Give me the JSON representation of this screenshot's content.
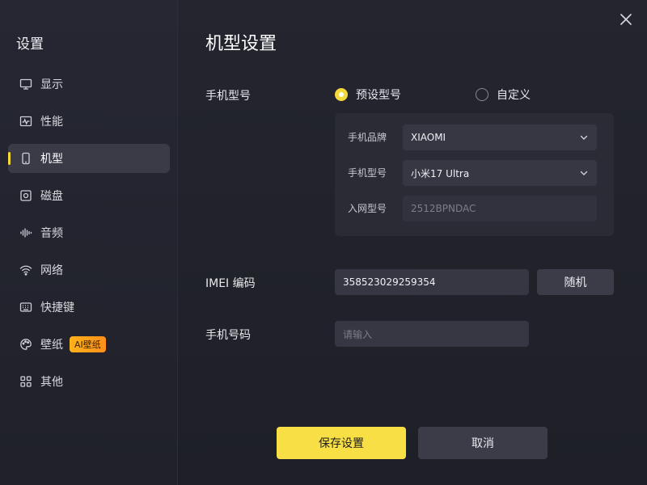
{
  "sidebar": {
    "title": "设置",
    "items": [
      {
        "label": "显示",
        "icon": "monitor-icon"
      },
      {
        "label": "性能",
        "icon": "performance-icon"
      },
      {
        "label": "机型",
        "icon": "phone-icon",
        "active": true
      },
      {
        "label": "磁盘",
        "icon": "disk-icon"
      },
      {
        "label": "音频",
        "icon": "audio-icon"
      },
      {
        "label": "网络",
        "icon": "wifi-icon"
      },
      {
        "label": "快捷键",
        "icon": "keyboard-icon"
      },
      {
        "label": "壁纸",
        "icon": "palette-icon",
        "badge": "AI壁纸"
      },
      {
        "label": "其他",
        "icon": "grid-icon"
      }
    ]
  },
  "main": {
    "title": "机型设置",
    "model": {
      "label": "手机型号",
      "option_preset": "预设型号",
      "option_custom": "自定义",
      "selected": "preset"
    },
    "panel": {
      "brand_label": "手机品牌",
      "brand_value": "XIAOMI",
      "model_label": "手机型号",
      "model_value": "小米17 Ultra",
      "network_label": "入网型号",
      "network_value": "2512BPNDAC"
    },
    "imei": {
      "label": "IMEI 编码",
      "value": "358523029259354",
      "random_button": "随机"
    },
    "phone": {
      "label": "手机号码",
      "placeholder": "请输入"
    },
    "buttons": {
      "save": "保存设置",
      "cancel": "取消"
    }
  },
  "colors": {
    "accent": "#f7df45",
    "badge": "#ffa41a"
  }
}
